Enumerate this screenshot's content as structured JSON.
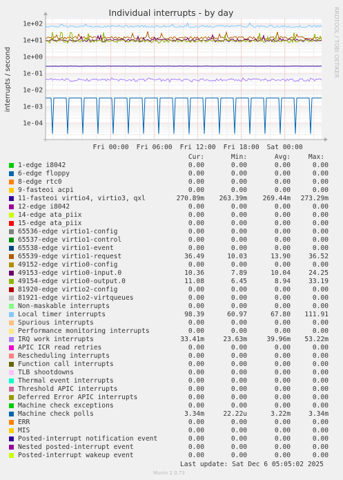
{
  "title": "Individual interrupts - by day",
  "side_label": "RRDTOOL / TOBI OETIKER",
  "ylabel": "interrupts / second",
  "columns": [
    "Cur:",
    "Min:",
    "Avg:",
    "Max:"
  ],
  "last_update": "Last update:  Sat Dec  6 05:05:02 2025",
  "munin_version": "Munin 2.0.73",
  "chart_data": {
    "type": "line",
    "y_scale": "log",
    "ylim": [
      1e-05,
      200
    ],
    "y_ticks": [
      "1e+02",
      "1e+01",
      "1e+00",
      "1e-01",
      "1e-02",
      "1e-03",
      "1e-04"
    ],
    "y_tick_values": [
      100,
      10,
      1,
      0.1,
      0.01,
      0.001,
      0.0001
    ],
    "x_ticks": [
      "Fri 00:00",
      "Fri 06:00",
      "Fri 12:00",
      "Fri 18:00",
      "Sat 00:00"
    ],
    "x_range_hours": [
      -9,
      29.08
    ],
    "x_tick_hours": [
      0,
      6,
      12,
      18,
      24
    ],
    "series": [
      {
        "name": "1-edge i8042",
        "color": "#00cc00",
        "cur": "0.00",
        "min": "0.00",
        "avg": "0.00",
        "max": "0.00"
      },
      {
        "name": "6-edge floppy",
        "color": "#0066b3",
        "cur": "0.00",
        "min": "0.00",
        "avg": "0.00",
        "max": "0.00"
      },
      {
        "name": "8-edge rtc0",
        "color": "#ff8000",
        "cur": "0.00",
        "min": "0.00",
        "avg": "0.00",
        "max": "0.00"
      },
      {
        "name": "9-fasteoi acpi",
        "color": "#ffcc00",
        "cur": "0.00",
        "min": "0.00",
        "avg": "0.00",
        "max": "0.00"
      },
      {
        "name": "11-fasteoi virtio4, virtio3, qxl",
        "color": "#330099",
        "cur": "270.89m",
        "min": "263.39m",
        "avg": "269.44m",
        "max": "273.29m"
      },
      {
        "name": "12-edge i8042",
        "color": "#990099",
        "cur": "0.00",
        "min": "0.00",
        "avg": "0.00",
        "max": "0.00"
      },
      {
        "name": "14-edge ata_piix",
        "color": "#ccff00",
        "cur": "0.00",
        "min": "0.00",
        "avg": "0.00",
        "max": "0.00"
      },
      {
        "name": "15-edge ata_piix",
        "color": "#ff0000",
        "cur": "0.00",
        "min": "0.00",
        "avg": "0.00",
        "max": "0.00"
      },
      {
        "name": "65536-edge virtio1-config",
        "color": "#808080",
        "cur": "0.00",
        "min": "0.00",
        "avg": "0.00",
        "max": "0.00"
      },
      {
        "name": "65537-edge virtio1-control",
        "color": "#008f00",
        "cur": "0.00",
        "min": "0.00",
        "avg": "0.00",
        "max": "0.00"
      },
      {
        "name": "65538-edge virtio1-event",
        "color": "#00487d",
        "cur": "0.00",
        "min": "0.00",
        "avg": "0.00",
        "max": "0.00"
      },
      {
        "name": "65539-edge virtio1-request",
        "color": "#b35a00",
        "cur": "36.49",
        "min": "10.03",
        "avg": "13.90",
        "max": "36.52"
      },
      {
        "name": "49152-edge virtio0-config",
        "color": "#b38f00",
        "cur": "0.00",
        "min": "0.00",
        "avg": "0.00",
        "max": "0.00"
      },
      {
        "name": "49153-edge virtio0-input.0",
        "color": "#6b006b",
        "cur": "10.36",
        "min": "7.89",
        "avg": "10.04",
        "max": "24.25"
      },
      {
        "name": "49154-edge virtio0-output.0",
        "color": "#8fb300",
        "cur": "11.08",
        "min": "6.45",
        "avg": "8.94",
        "max": "33.19"
      },
      {
        "name": "81920-edge virtio2-config",
        "color": "#b30000",
        "cur": "0.00",
        "min": "0.00",
        "avg": "0.00",
        "max": "0.00"
      },
      {
        "name": "81921-edge virtio2-virtqueues",
        "color": "#bebebe",
        "cur": "0.00",
        "min": "0.00",
        "avg": "0.00",
        "max": "0.00"
      },
      {
        "name": "Non-maskable interrupts",
        "color": "#80ff80",
        "cur": "0.00",
        "min": "0.00",
        "avg": "0.00",
        "max": "0.00"
      },
      {
        "name": "Local timer interrupts",
        "color": "#80c9ff",
        "cur": "98.39",
        "min": "60.97",
        "avg": "67.80",
        "max": "111.91"
      },
      {
        "name": "Spurious interrupts",
        "color": "#ffc080",
        "cur": "0.00",
        "min": "0.00",
        "avg": "0.00",
        "max": "0.00"
      },
      {
        "name": "Performance monitoring interrupts",
        "color": "#ffe680",
        "cur": "0.00",
        "min": "0.00",
        "avg": "0.00",
        "max": "0.00"
      },
      {
        "name": "IRQ work interrupts",
        "color": "#aa80ff",
        "cur": "33.41m",
        "min": "23.63m",
        "avg": "39.96m",
        "max": "53.22m"
      },
      {
        "name": "APIC ICR read retries",
        "color": "#ee00cc",
        "cur": "0.00",
        "min": "0.00",
        "avg": "0.00",
        "max": "0.00"
      },
      {
        "name": "Rescheduling interrupts",
        "color": "#ff8080",
        "cur": "0.00",
        "min": "0.00",
        "avg": "0.00",
        "max": "0.00"
      },
      {
        "name": "Function call interrupts",
        "color": "#666600",
        "cur": "0.00",
        "min": "0.00",
        "avg": "0.00",
        "max": "0.00"
      },
      {
        "name": "TLB shootdowns",
        "color": "#ffbfff",
        "cur": "0.00",
        "min": "0.00",
        "avg": "0.00",
        "max": "0.00"
      },
      {
        "name": "Thermal event interrupts",
        "color": "#00ffcc",
        "cur": "0.00",
        "min": "0.00",
        "avg": "0.00",
        "max": "0.00"
      },
      {
        "name": "Threshold APIC interrupts",
        "color": "#cc6699",
        "cur": "0.00",
        "min": "0.00",
        "avg": "0.00",
        "max": "0.00"
      },
      {
        "name": "Deferred Error APIC interrupts",
        "color": "#999900",
        "cur": "0.00",
        "min": "0.00",
        "avg": "0.00",
        "max": "0.00"
      },
      {
        "name": "Machine check exceptions",
        "color": "#00cc00",
        "cur": "0.00",
        "min": "0.00",
        "avg": "0.00",
        "max": "0.00"
      },
      {
        "name": "Machine check polls",
        "color": "#0066b3",
        "cur": "3.34m",
        "min": "22.22u",
        "avg": "3.22m",
        "max": "3.34m"
      },
      {
        "name": "ERR",
        "color": "#ff8000",
        "cur": "0.00",
        "min": "0.00",
        "avg": "0.00",
        "max": "0.00"
      },
      {
        "name": "MIS",
        "color": "#ffcc00",
        "cur": "0.00",
        "min": "0.00",
        "avg": "0.00",
        "max": "0.00"
      },
      {
        "name": "Posted-interrupt notification event",
        "color": "#330099",
        "cur": "0.00",
        "min": "0.00",
        "avg": "0.00",
        "max": "0.00"
      },
      {
        "name": "Nested posted-interrupt event",
        "color": "#990099",
        "cur": "0.00",
        "min": "0.00",
        "avg": "0.00",
        "max": "0.00"
      },
      {
        "name": "Posted-interrupt wakeup event",
        "color": "#ccff00",
        "cur": "0.00",
        "min": "0.00",
        "avg": "0.00",
        "max": "0.00"
      }
    ]
  }
}
